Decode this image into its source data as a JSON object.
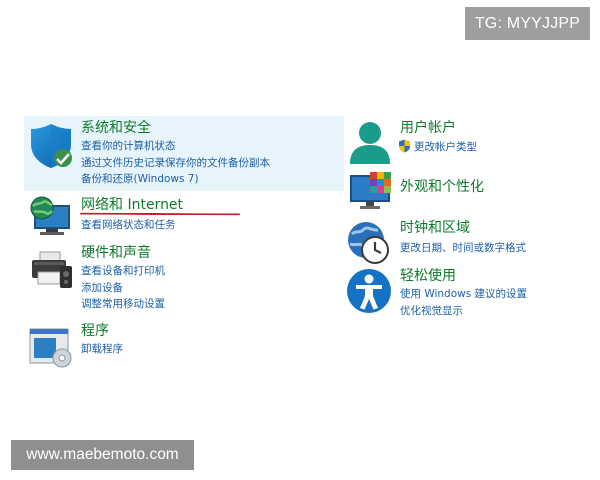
{
  "watermarks": {
    "telegram": "TG: MYYJJPP",
    "site": "www.maebemoto.com"
  },
  "colors": {
    "category_title": "#0e7a2c",
    "link": "#1c5fa8",
    "highlight_background": "#e8f4fb",
    "underline": "#c81e2a",
    "watermark_bg": "#9e9e9e"
  },
  "left_column": [
    {
      "title": "系统和安全",
      "icon": "shield-icon",
      "links": [
        "查看你的计算机状态",
        "通过文件历史记录保存你的文件备份副本",
        "备份和还原(Windows 7)"
      ]
    },
    {
      "title": "网络和 Internet",
      "icon": "globe-monitor-icon",
      "links": [
        "查看网络状态和任务"
      ]
    },
    {
      "title": "硬件和声音",
      "icon": "printer-icon",
      "links": [
        "查看设备和打印机",
        "添加设备",
        "调整常用移动设置"
      ]
    },
    {
      "title": "程序",
      "icon": "programs-icon",
      "links": [
        "卸载程序"
      ]
    }
  ],
  "right_column": [
    {
      "title": "用户帐户",
      "icon": "user-icon",
      "links": [
        "更改帐户类型"
      ],
      "link_icon": "uac-shield-icon"
    },
    {
      "title": "外观和个性化",
      "icon": "monitor-palette-icon",
      "links": []
    },
    {
      "title": "时钟和区域",
      "icon": "clock-globe-icon",
      "links": [
        "更改日期、时间或数字格式"
      ]
    },
    {
      "title": "轻松使用",
      "icon": "accessibility-icon",
      "links": [
        "使用 Windows 建议的设置",
        "优化视觉显示"
      ]
    }
  ]
}
